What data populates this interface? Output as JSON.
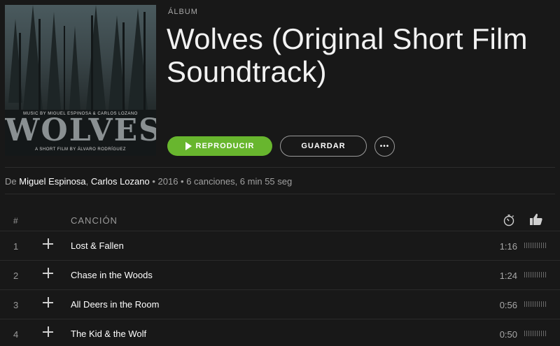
{
  "album": {
    "type_label": "ÁLBUM",
    "title": "Wolves (Original Short Film Soundtrack)",
    "cover": {
      "credit_top": "MUSIC BY MIGUEL ESPINOSA & CARLOS LOZANO",
      "logo_text": "WOLVES",
      "credit_bottom": "A SHORT FILM BY ÁLVARO RODRÍGUEZ"
    }
  },
  "actions": {
    "play_label": "REPRODUCIR",
    "save_label": "GUARDAR",
    "more_label": "•••"
  },
  "meta": {
    "prefix": "De",
    "artist1": "Miguel Espinosa",
    "separator": ",",
    "artist2": "Carlos Lozano",
    "details": "• 2016 • 6 canciones, 6 min 55 seg"
  },
  "tracks_header": {
    "number": "#",
    "song": "CANCIÓN",
    "duration_icon": "stopwatch-icon",
    "like_icon": "thumbs-up-icon"
  },
  "tracks": [
    {
      "number": "1",
      "title": "Lost & Fallen",
      "duration": "1:16"
    },
    {
      "number": "2",
      "title": "Chase in the Woods",
      "duration": "1:24"
    },
    {
      "number": "3",
      "title": "All Deers in the Room",
      "duration": "0:56"
    },
    {
      "number": "4",
      "title": "The Kid & the Wolf",
      "duration": "0:50"
    }
  ],
  "colors": {
    "background": "#181818",
    "accent_green": "#68b62e",
    "muted_text": "#a0a0a0"
  }
}
